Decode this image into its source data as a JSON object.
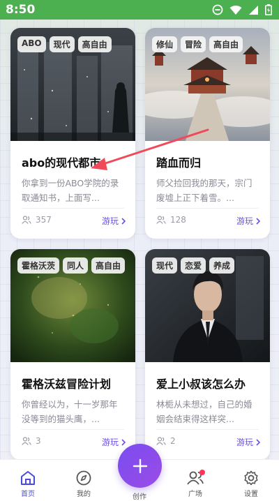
{
  "status_bar": {
    "time": "8:50"
  },
  "cards": [
    {
      "tags": [
        "ABO",
        "现代",
        "高自由"
      ],
      "title": "abo的现代都市",
      "desc": "你拿到一份ABO学院的录取通知书，上面写...",
      "players": "357",
      "play_label": "游玩"
    },
    {
      "tags": [
        "修仙",
        "冒险",
        "高自由"
      ],
      "title": "踏血而归",
      "desc": "师父捡回我的那天，宗门废墟上正下着雪。...",
      "players": "128",
      "play_label": "游玩"
    },
    {
      "tags": [
        "霍格沃茨",
        "同人",
        "高自由"
      ],
      "title": "霍格沃兹冒险计划",
      "desc": "你曾经以为，十一岁那年没等到的猫头鹰，...",
      "players": "3",
      "play_label": "游玩"
    },
    {
      "tags": [
        "现代",
        "恋爱",
        "养成"
      ],
      "title": "爱上小叔该怎么办",
      "desc": "林栀从未想过，自己的婚姻会结束得这样突...",
      "players": "2",
      "play_label": "游玩"
    }
  ],
  "bottom_nav": {
    "home": "首页",
    "mine": "我的",
    "create": "创作",
    "square": "广场",
    "settings": "设置"
  },
  "colors": {
    "accent": "#6b4de6",
    "status_bar": "#4caf50",
    "badge": "#ff3355"
  }
}
